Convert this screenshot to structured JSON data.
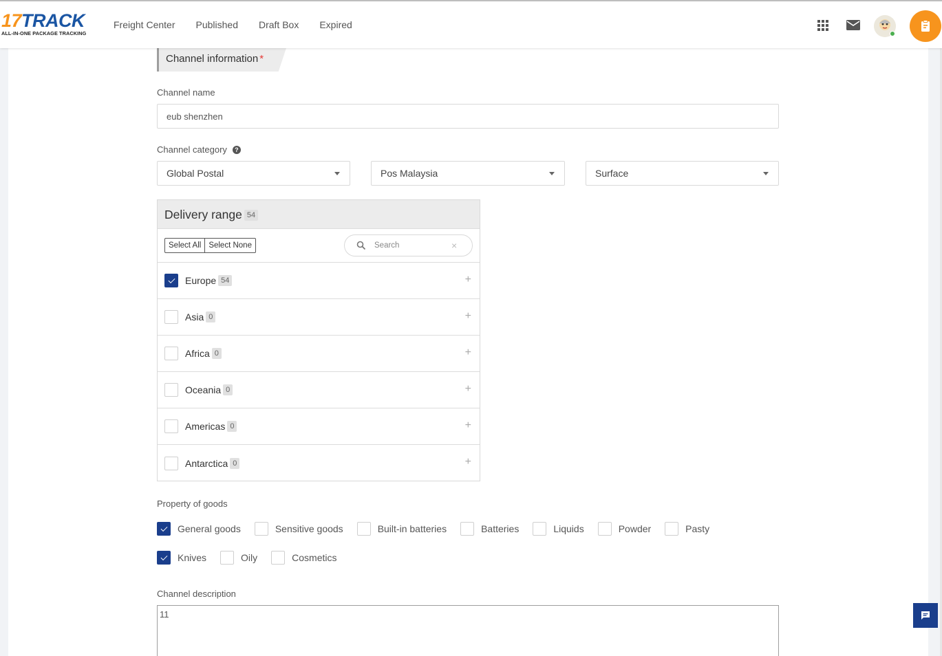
{
  "logo": {
    "numeral": "17",
    "word": "TRACK",
    "tagline": "ALL-IN-ONE PACKAGE TRACKING"
  },
  "nav": [
    {
      "label": "Freight Center"
    },
    {
      "label": "Published"
    },
    {
      "label": "Draft Box"
    },
    {
      "label": "Expired"
    }
  ],
  "section": {
    "title": "Channel information",
    "required_mark": "*"
  },
  "channel_name": {
    "label": "Channel name",
    "value": "eub shenzhen"
  },
  "channel_category": {
    "label": "Channel category",
    "help": "?",
    "selects": [
      {
        "value": "Global Postal"
      },
      {
        "value": "Pos Malaysia"
      },
      {
        "value": "Surface"
      }
    ]
  },
  "delivery_range": {
    "title": "Delivery range",
    "count": "54",
    "select_all": "Select All",
    "select_none": "Select None",
    "search_placeholder": "Search",
    "regions": [
      {
        "name": "Europe",
        "count": "54",
        "checked": true
      },
      {
        "name": "Asia",
        "count": "0",
        "checked": false
      },
      {
        "name": "Africa",
        "count": "0",
        "checked": false
      },
      {
        "name": "Oceania",
        "count": "0",
        "checked": false
      },
      {
        "name": "Americas",
        "count": "0",
        "checked": false
      },
      {
        "name": "Antarctica",
        "count": "0",
        "checked": false
      }
    ]
  },
  "goods": {
    "label": "Property of goods",
    "row1": [
      {
        "name": "General goods",
        "checked": true
      },
      {
        "name": "Sensitive goods",
        "checked": false
      },
      {
        "name": "Built-in batteries",
        "checked": false
      },
      {
        "name": "Batteries",
        "checked": false
      },
      {
        "name": "Liquids",
        "checked": false
      },
      {
        "name": "Powder",
        "checked": false
      },
      {
        "name": "Pasty",
        "checked": false
      }
    ],
    "row2": [
      {
        "name": "Knives",
        "checked": true
      },
      {
        "name": "Oily",
        "checked": false
      },
      {
        "name": "Cosmetics",
        "checked": false
      }
    ]
  },
  "description": {
    "label": "Channel description",
    "value": "11"
  },
  "colors": {
    "brand_orange": "#f7941d",
    "brand_blue": "#1a55a3",
    "check_blue": "#1a3e8c"
  }
}
